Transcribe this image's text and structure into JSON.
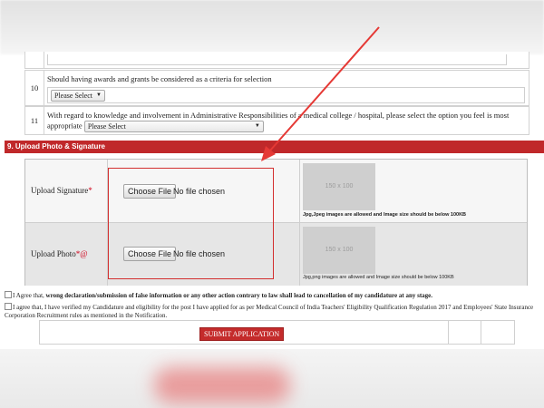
{
  "questions": [
    {
      "number": "10",
      "text": "Should having awards and grants be considered as a criteria for selection",
      "select_value": "Please Select"
    },
    {
      "number": "11",
      "text": "With regard to knowledge and involvement in Administrative Responsibilities of a medical college / hospital, please select the option you feel is most appropriate",
      "select_value": "Please Select"
    }
  ],
  "section": {
    "title": "9. Upload Photo & Signature"
  },
  "uploads": [
    {
      "label": "Upload Signature",
      "marker": "*",
      "button": "Choose File",
      "status": "No file chosen",
      "preview": "150 x 100",
      "note": "Jpg,Jpeg images are allowed and Image size should be below 100KB"
    },
    {
      "label": "Upload Photo",
      "marker": "*@",
      "button": "Choose File",
      "status": "No file chosen",
      "preview": "150 x 100",
      "note": "Jpg,png images are allowed and Image size should be below 100KB"
    }
  ],
  "agreements": [
    {
      "prefix": "I Agree that, ",
      "bold": "wrong declaration/submission of false information or any other action contrary to law shall lead to cancellation of my candidature at any stage."
    },
    {
      "text": "I agree that, I have verified my Candidature and eligibility for the post I have applied for as per Medical Council of India Teachers' Eligibility Qualification Regulation 2017 and Employees' State Insurance Corporation Recruitment rules as mentioned in the Notification."
    }
  ],
  "submit": {
    "label": "SUBMIT APPLICATION"
  },
  "colors": {
    "section_bar": "#c0282a",
    "annotation": "#d32f2f",
    "submit": "#c42b2b"
  }
}
